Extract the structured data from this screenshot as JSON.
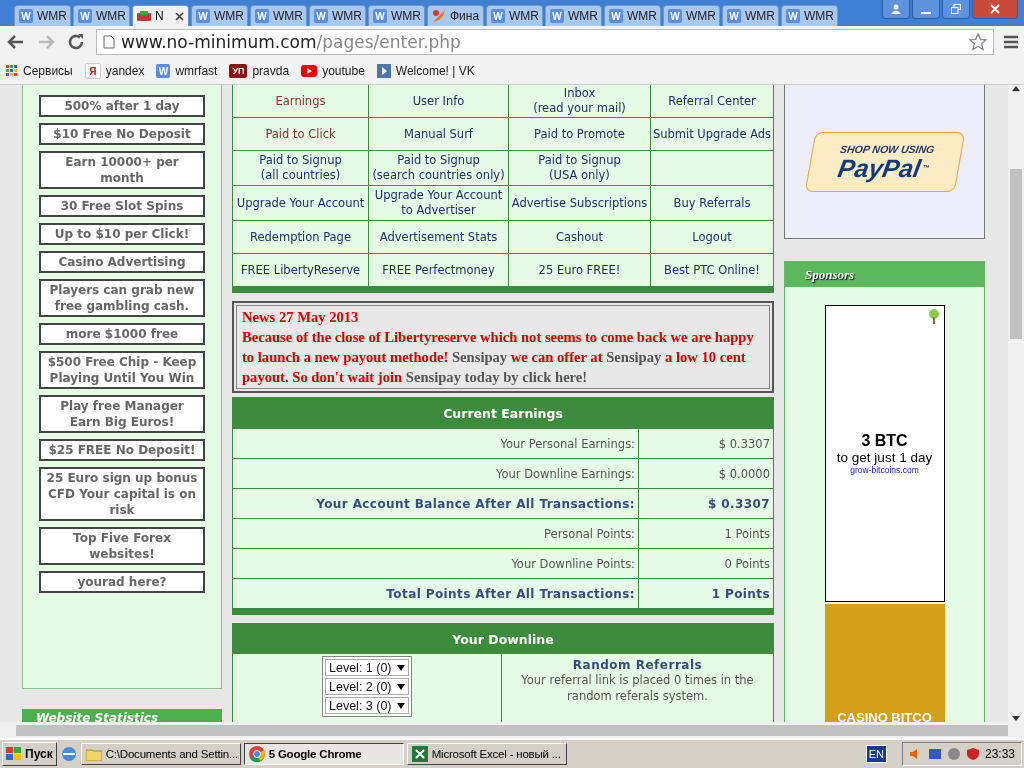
{
  "browser": {
    "tabs": [
      {
        "title": "WMR",
        "kind": "wmr",
        "icon_text": "W",
        "selected": false
      },
      {
        "title": "WMR",
        "kind": "wmr",
        "icon_text": "W",
        "selected": false
      },
      {
        "title": "N",
        "kind": "site",
        "selected": true
      },
      {
        "title": "WMR",
        "kind": "wmr",
        "icon_text": "W",
        "selected": false
      },
      {
        "title": "WMR",
        "kind": "wmr",
        "icon_text": "W",
        "selected": false
      },
      {
        "title": "WMR",
        "kind": "wmr",
        "icon_text": "W",
        "selected": false
      },
      {
        "title": "WMR",
        "kind": "wmr",
        "icon_text": "W",
        "selected": false
      },
      {
        "title": "Фина",
        "kind": "finance",
        "selected": false
      },
      {
        "title": "WMR",
        "kind": "wmr",
        "icon_text": "W",
        "selected": false
      },
      {
        "title": "WMR",
        "kind": "wmr",
        "icon_text": "W",
        "selected": false
      },
      {
        "title": "WMR",
        "kind": "wmr",
        "icon_text": "W",
        "selected": false
      },
      {
        "title": "WMR",
        "kind": "wmr",
        "icon_text": "W",
        "selected": false
      },
      {
        "title": "WMR",
        "kind": "wmr",
        "icon_text": "W",
        "selected": false
      },
      {
        "title": "WMR",
        "kind": "wmr",
        "icon_text": "W",
        "selected": false
      }
    ],
    "url": {
      "host": "www.no-minimum.com",
      "path": "/pages/enter.php"
    },
    "bookmarks": [
      {
        "label": "Сервисы",
        "kind": "apps"
      },
      {
        "label": "yandex",
        "kind": "yandex",
        "icon_text": "Я"
      },
      {
        "label": "wmrfast",
        "kind": "wmr",
        "icon_text": "W"
      },
      {
        "label": "pravda",
        "kind": "pravda",
        "icon_text": "УП"
      },
      {
        "label": "youtube",
        "kind": "youtube"
      },
      {
        "label": "Welcome! | VK",
        "kind": "vk"
      }
    ]
  },
  "left_ads": [
    "500% after 1 day",
    "$10 Free No Deposit",
    "Earn 10000+ per month",
    "30 Free Slot Spins",
    "Up to $10 per Click!",
    "Casino Advertising",
    "Players can grab new free gambling cash.",
    "more $1000 free",
    "$500 Free Chip - Keep Playing Until You Win",
    "Play free Manager Earn Big Euros!",
    "$25 FREE No Deposit!",
    "25 Euro sign up bonus CFD Your capital is on risk",
    "Top Five Forex websites!",
    "yourad here?"
  ],
  "left_footer": "Website Statistics",
  "nav": [
    [
      {
        "label": "Earnings",
        "visited": true
      },
      {
        "label": "User Info",
        "visited": false
      },
      {
        "label": "Inbox\n(read your mail)",
        "visited": false
      },
      {
        "label": "Referral Center",
        "visited": false
      }
    ],
    [
      {
        "label": "Paid to Click",
        "visited": true
      },
      {
        "label": "Manual Surf",
        "visited": false
      },
      {
        "label": "Paid to Promote",
        "visited": false
      },
      {
        "label": "Submit Upgrade Ads",
        "visited": false
      }
    ],
    [
      {
        "label": "Paid to Signup\n(all countries)",
        "visited": false
      },
      {
        "label": "Paid to Signup\n(search countries only)",
        "visited": false
      },
      {
        "label": "Paid to Signup\n(USA only)",
        "visited": false
      },
      {
        "kind": "empty"
      }
    ],
    [
      {
        "label": "Upgrade Your Account",
        "visited": false
      },
      {
        "label": "Upgrade Your Account\nto Advertiser",
        "visited": false
      },
      {
        "label": "Advertise Subscriptions",
        "visited": false
      },
      {
        "label": "Buy Referrals",
        "visited": false
      }
    ],
    [
      {
        "label": "Redemption Page",
        "visited": false
      },
      {
        "label": "Advertisement Stats",
        "visited": false
      },
      {
        "label": "Cashout",
        "visited": false
      },
      {
        "label": "Logout",
        "visited": false
      }
    ],
    [
      {
        "label": "FREE LibertyReserve",
        "visited": false
      },
      {
        "label": "FREE Perfectmoney",
        "visited": false
      },
      {
        "label": "25 Euro FREE!",
        "visited": false
      },
      {
        "label": "Best PTC Online!",
        "visited": false
      }
    ]
  ],
  "news": {
    "title": "News 27 May 2013",
    "segments": [
      {
        "kind": "text",
        "text": "Because of the close of Libertyreserve which not seems to come back we are happy to launch a new payout methode! "
      },
      {
        "kind": "link",
        "text": "Sensipay"
      },
      {
        "kind": "text",
        "text": " we can offer at "
      },
      {
        "kind": "link",
        "text": "Sensipay"
      },
      {
        "kind": "text",
        "text": " a low 10 cent payout. So don't wait join "
      },
      {
        "kind": "link",
        "text": "Sensipay today by click here!"
      }
    ]
  },
  "earnings": {
    "title": "Current Earnings",
    "rows": [
      {
        "label": "Your Personal Earnings:",
        "value": "$  0.3307",
        "bold": false
      },
      {
        "label": "Your Downline Earnings:",
        "value": "$  0.0000",
        "bold": false
      },
      {
        "label": "Your Account Balance After All Transactions:",
        "value": "$  0.3307",
        "bold": true
      },
      {
        "label": "Personal Points:",
        "value": "1 Points",
        "bold": false
      },
      {
        "label": "Your Downline Points:",
        "value": "0 Points",
        "bold": false
      },
      {
        "label": "Total Points After All Transactions:",
        "value": "1 Points",
        "bold": true
      }
    ]
  },
  "downline": {
    "title": "Your Downline",
    "levels": [
      "Level: 1 (0)",
      "Level: 2 (0)",
      "Level: 3 (0)"
    ],
    "random_title": "Random Referrals",
    "random_text": "Your referral link is placed 0 times in the random referals system."
  },
  "paypal": {
    "tagline": "SHOP NOW USING",
    "brand": "PayPal",
    "tm": "™"
  },
  "sponsors": {
    "title": "Sponsors",
    "ad_headline": "3 BTC",
    "ad_text": "to get just 1 day",
    "ad_link": "grow-bitcoins.com",
    "ad2_text": "CASINO BITCO"
  },
  "taskbar": {
    "start": "Пуск",
    "tasks": [
      {
        "label": "C:\\Documents and Settin...",
        "kind": "folder",
        "selected": false
      },
      {
        "label": "5 Google Chrome",
        "kind": "chrome",
        "selected": true
      },
      {
        "label": "Microsoft Excel - новый ...",
        "kind": "excel",
        "selected": false
      }
    ],
    "language": "EN",
    "clock": "23:33"
  }
}
